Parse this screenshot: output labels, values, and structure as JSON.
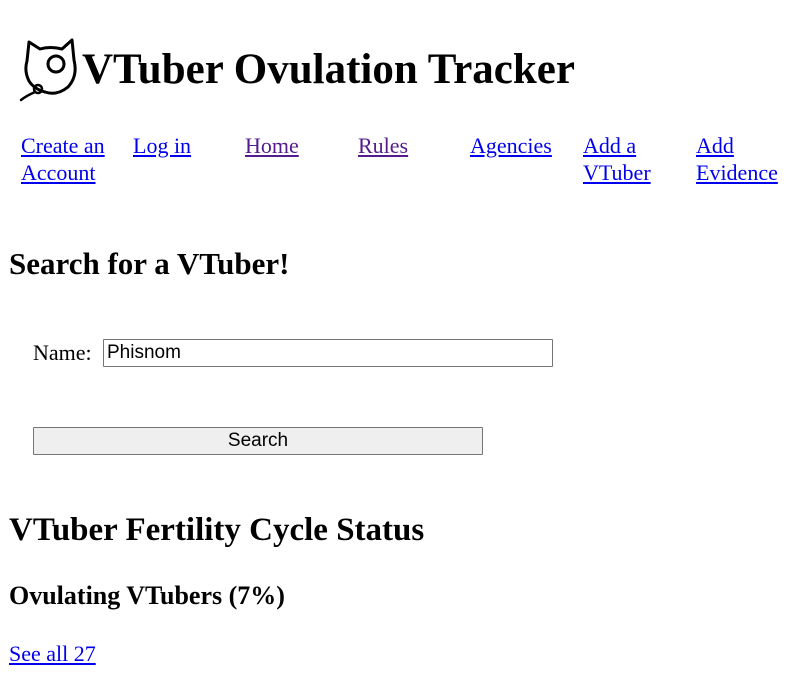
{
  "site": {
    "title": "VTuber Ovulation Tracker",
    "logo_icon": "cat-ovum-logo-icon"
  },
  "nav": {
    "create_account": "Create an Account",
    "log_in": "Log in",
    "home": "Home",
    "rules": "Rules",
    "agencies": "Agencies",
    "add_vtuber": "Add a VTuber",
    "add_evidence": "Add Evidence"
  },
  "search": {
    "heading": "Search for a VTuber!",
    "name_label": "Name:",
    "name_value": "Phisnom",
    "button_label": "Search"
  },
  "status": {
    "heading": "VTuber Fertility Cycle Status",
    "ovulating_heading": "Ovulating VTubers (7%)",
    "see_all_link": "See all 27"
  },
  "colors": {
    "link": "#0000ee",
    "visited_link": "#551a8b",
    "button_bg": "#efefef",
    "border": "#767676"
  }
}
